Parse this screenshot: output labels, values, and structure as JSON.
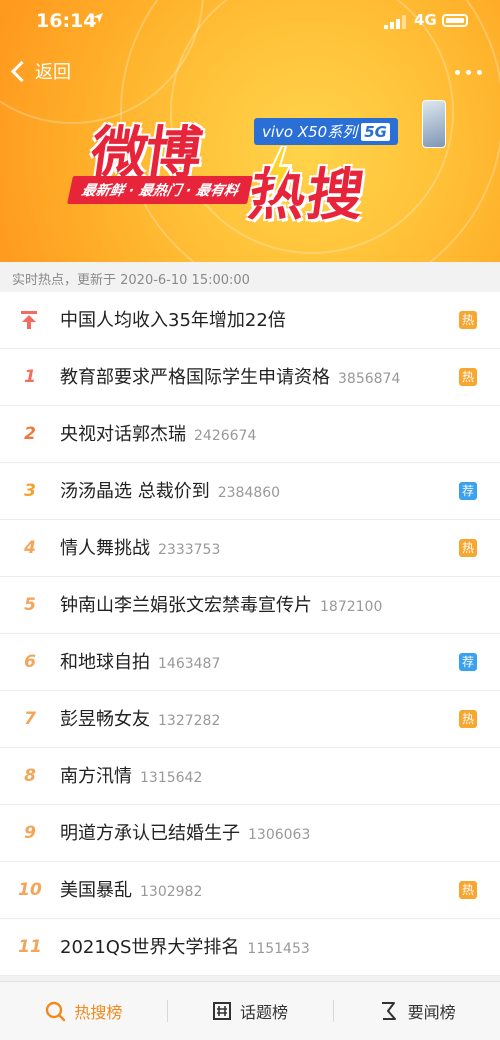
{
  "status_bar": {
    "time": "16:14",
    "network": "4G"
  },
  "header": {
    "back_label": "返回",
    "banner_title_1": "微博",
    "banner_title_2": "热搜",
    "slogan": "最新鲜 · 最热门 · 最有料",
    "sponsor_brand": "vivo X50系列",
    "sponsor_5g": "5G"
  },
  "updated_text": "实时热点，更新于 2020-6-10 15:00:00",
  "colors": {
    "accent": "#f08a1e",
    "hot_tag": "#f7a630",
    "rec_tag": "#3aa0f0",
    "brand_red": "#e8243a"
  },
  "items": [
    {
      "rank": "",
      "pinned": true,
      "title": "中国人均收入35年增加22倍",
      "count": "",
      "tag": "热",
      "tag_type": "hot"
    },
    {
      "rank": "1",
      "title": "教育部要求严格国际学生申请资格",
      "count": "3856874",
      "tag": "热",
      "tag_type": "hot"
    },
    {
      "rank": "2",
      "title": "央视对话郭杰瑞",
      "count": "2426674",
      "tag": "",
      "tag_type": ""
    },
    {
      "rank": "3",
      "title": "汤汤晶选 总裁价到",
      "count": "2384860",
      "tag": "荐",
      "tag_type": "rec"
    },
    {
      "rank": "4",
      "title": "情人舞挑战",
      "count": "2333753",
      "tag": "热",
      "tag_type": "hot"
    },
    {
      "rank": "5",
      "title": "钟南山李兰娟张文宏禁毒宣传片",
      "count": "1872100",
      "tag": "",
      "tag_type": ""
    },
    {
      "rank": "6",
      "title": "和地球自拍",
      "count": "1463487",
      "tag": "荐",
      "tag_type": "rec"
    },
    {
      "rank": "7",
      "title": "彭昱畅女友",
      "count": "1327282",
      "tag": "热",
      "tag_type": "hot"
    },
    {
      "rank": "8",
      "title": "南方汛情",
      "count": "1315642",
      "tag": "",
      "tag_type": ""
    },
    {
      "rank": "9",
      "title": "明道方承认已结婚生子",
      "count": "1306063",
      "tag": "",
      "tag_type": ""
    },
    {
      "rank": "10",
      "title": "美国暴乱",
      "count": "1302982",
      "tag": "热",
      "tag_type": "hot"
    },
    {
      "rank": "11",
      "title": "2021QS世界大学排名",
      "count": "1151453",
      "tag": "",
      "tag_type": ""
    }
  ],
  "tabs": [
    {
      "label": "热搜榜",
      "icon": "search-icon",
      "active": true
    },
    {
      "label": "话题榜",
      "icon": "topic-icon",
      "active": false
    },
    {
      "label": "要闻榜",
      "icon": "news-icon",
      "active": false
    }
  ]
}
